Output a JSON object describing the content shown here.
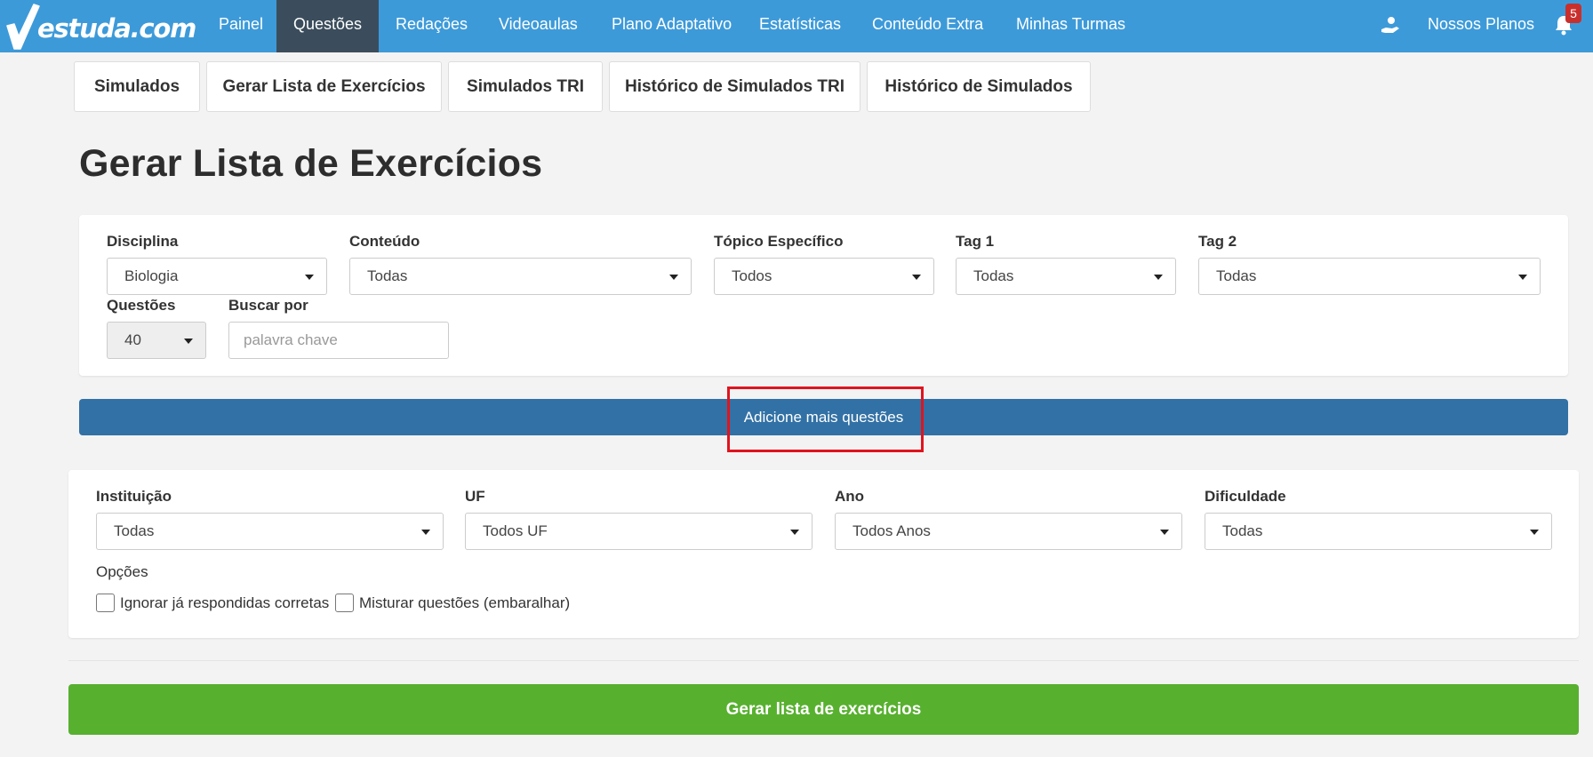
{
  "brand": {
    "logo_text": "estuda.com"
  },
  "nav": {
    "items": [
      {
        "label": "Painel"
      },
      {
        "label": "Questões"
      },
      {
        "label": "Redações"
      },
      {
        "label": "Videoaulas"
      },
      {
        "label": "Plano Adaptativo"
      },
      {
        "label": "Estatísticas"
      },
      {
        "label": "Conteúdo Extra"
      },
      {
        "label": "Minhas Turmas"
      }
    ],
    "active": "Questões",
    "plans_label": "Nossos Planos",
    "notification_count": "5"
  },
  "subtabs": [
    {
      "label": "Simulados"
    },
    {
      "label": "Gerar Lista de Exercícios"
    },
    {
      "label": "Simulados TRI"
    },
    {
      "label": "Histórico de Simulados TRI"
    },
    {
      "label": "Histórico de Simulados"
    }
  ],
  "page_title": "Gerar Lista de Exercícios",
  "filters": {
    "disciplina": {
      "label": "Disciplina",
      "value": "Biologia"
    },
    "conteudo": {
      "label": "Conteúdo",
      "value": "Todas"
    },
    "topico": {
      "label": "Tópico Específico",
      "value": "Todos"
    },
    "tag1": {
      "label": "Tag 1",
      "value": "Todas"
    },
    "tag2": {
      "label": "Tag 2",
      "value": "Todas"
    },
    "questoes": {
      "label": "Questões",
      "value": "40"
    },
    "buscar": {
      "label": "Buscar por",
      "placeholder": "palavra chave",
      "value": ""
    }
  },
  "add_more_label": "Adicione mais questões",
  "extra_filters": {
    "instituicao": {
      "label": "Instituição",
      "value": "Todas"
    },
    "uf": {
      "label": "UF",
      "value": "Todos UF"
    },
    "ano": {
      "label": "Ano",
      "value": "Todos Anos"
    },
    "dificuldade": {
      "label": "Dificuldade",
      "value": "Todas"
    },
    "opcoes_label": "Opções",
    "options": [
      {
        "label": "Ignorar já respondidas corretas",
        "checked": false
      },
      {
        "label": "Misturar questões (embaralhar)",
        "checked": false
      }
    ]
  },
  "generate_label": "Gerar lista de exercícios",
  "colors": {
    "navbar": "#3d9ad9",
    "nav_active": "#3b4d5c",
    "add_button": "#3271a5",
    "generate_button": "#58b02f",
    "highlight": "#e0141e",
    "badge": "#c9302c"
  }
}
